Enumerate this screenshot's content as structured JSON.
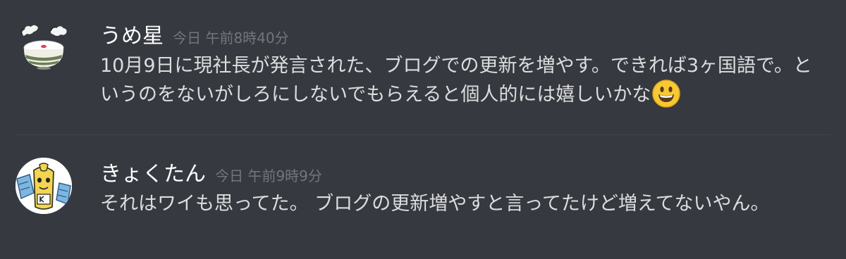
{
  "messages": [
    {
      "username": "うめ星",
      "timestamp": "今日 午前8時40分",
      "content": "10月9日に現社長が発言された、ブログでの更新を増やす。できれば3ヶ国語で。というのをないがしろにしないでもらえると個人的には嬉しいかな",
      "emoji": "smiley-emoji",
      "avatar": "rice-bowl-avatar"
    },
    {
      "username": "きょくたん",
      "timestamp": "今日 午前9時9分",
      "content": "それはワイも思ってた。 ブログの更新増やすと言ってたけど増えてないやん。",
      "avatar": "cartoon-character-avatar"
    }
  ],
  "colors": {
    "background": "#36393f",
    "username": "#ffffff",
    "timestamp": "#72767d",
    "text": "#dcddde",
    "divider": "#42454a"
  }
}
